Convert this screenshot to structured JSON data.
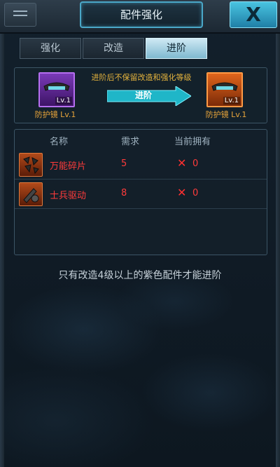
{
  "header": {
    "title": "配件强化",
    "close_label": "X"
  },
  "tabs": [
    {
      "label": "强化",
      "active": false
    },
    {
      "label": "改造",
      "active": false
    },
    {
      "label": "进阶",
      "active": true
    }
  ],
  "advance": {
    "notice": "进阶后不保留改造和强化等级",
    "button_label": "进阶",
    "from_item": {
      "name": "防护镜 Lv.1",
      "level": "Lv.1",
      "rarity_color": "#8a3fd0"
    },
    "to_item": {
      "name": "防护镜 Lv.1",
      "level": "Lv.1",
      "rarity_color": "#e0651c"
    }
  },
  "requirements": {
    "columns": [
      "名称",
      "需求",
      "当前拥有"
    ],
    "rows": [
      {
        "name": "万能碎片",
        "required": "5",
        "status_icon": "x-icon",
        "status_mark": "✕",
        "owned": "0"
      },
      {
        "name": "士兵驱动",
        "required": "8",
        "status_icon": "x-icon",
        "status_mark": "✕",
        "owned": "0"
      }
    ]
  },
  "hint": "只有改造4级以上的紫色配件才能进阶",
  "colors": {
    "accent": "#4aa7c8",
    "warning_text": "#e6b43d",
    "insufficient": "#ff3b3b"
  }
}
